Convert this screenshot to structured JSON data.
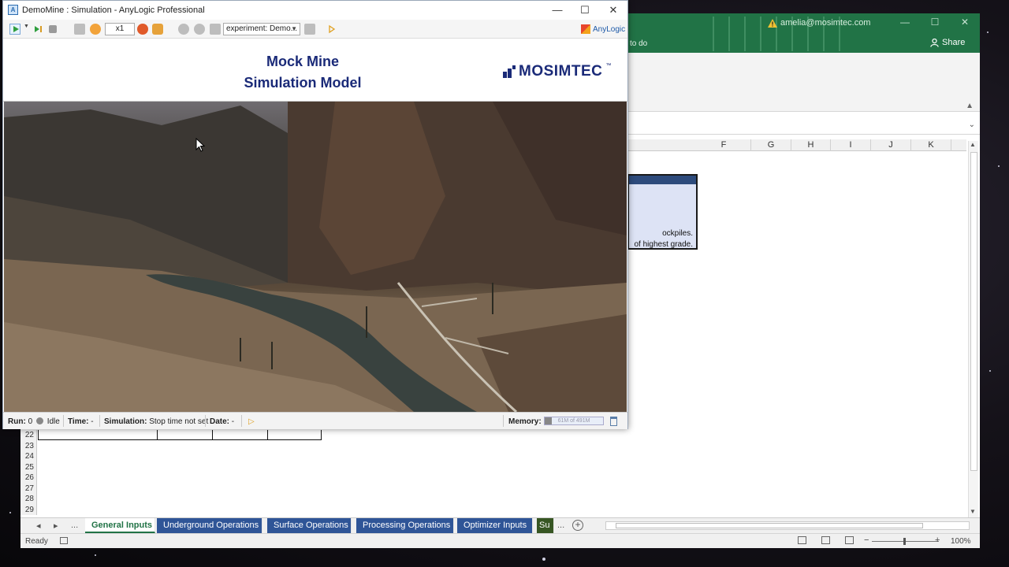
{
  "excel": {
    "account": "amelia@mosimtec.com",
    "share_label": "Share",
    "tell_me": "to do",
    "columns": [
      "F",
      "G",
      "H",
      "I",
      "J",
      "K"
    ],
    "rows": [
      "22",
      "23",
      "24",
      "25",
      "26",
      "27",
      "28",
      "29"
    ],
    "info_box": {
      "line1": "ockpiles.",
      "line2": "of highest grade."
    },
    "sheet_nav": {
      "prev": "◂",
      "next": "▸",
      "more": "..."
    },
    "sheets": [
      {
        "label": "General Inputs",
        "active": true
      },
      {
        "label": "Underground Operations"
      },
      {
        "label": "Surface Operations"
      },
      {
        "label": "Processing Operations"
      },
      {
        "label": "Optimizer Inputs"
      },
      {
        "label": "Su"
      }
    ],
    "tabs_more": "...",
    "add_sheet": "+",
    "status": "Ready",
    "zoom": "100%",
    "zoom_minus": "−",
    "zoom_plus": "+"
  },
  "anylogic": {
    "window_title": "DemoMine : Simulation - AnyLogic Professional",
    "win_buttons": {
      "minimize": "—",
      "maximize": "☐",
      "close": "✕"
    },
    "speed": "x1",
    "experiment": "experiment: Demo...",
    "brand": "AnyLogic",
    "model_title_line1": "Mock Mine",
    "model_title_line2": "Simulation Model",
    "company_logo": "MOSIMTEC",
    "company_tm": "™",
    "status": {
      "run_label": "Run:",
      "run_value": "0",
      "run_state": "Idle",
      "time_label": "Time:",
      "time_value": "-",
      "simulation_label": "Simulation:",
      "simulation_value": "Stop time not set",
      "date_label": "Date:",
      "date_value": "-",
      "memory_label": "Memory:",
      "memory_value": "61M of 491M"
    }
  }
}
